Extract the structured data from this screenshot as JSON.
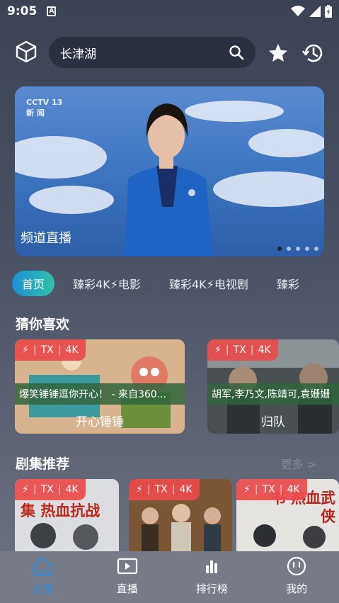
{
  "status": {
    "time": "9:05",
    "notification_letter": "A"
  },
  "search": {
    "query": "长津湖"
  },
  "banner": {
    "caption": "频道直播",
    "logo_text": "CCTV 13\n新 闻",
    "dots": 5,
    "active_dot": 0
  },
  "categories": [
    "首页",
    "臻彩4K⚡电影",
    "臻彩4K⚡电视剧",
    "臻彩"
  ],
  "guess": {
    "title": "猜你喜欢",
    "items": [
      {
        "tag": [
          "TX",
          "4K"
        ],
        "desc": "爆笑锤锤逗你开心！ - 来自360...",
        "name": "开心锤锤"
      },
      {
        "tag": [
          "TX",
          "4K"
        ],
        "desc": "胡军,李乃文,陈靖可,袁姗姗",
        "name": "归队"
      }
    ]
  },
  "series": {
    "title": "剧集推荐",
    "more": "更多 >",
    "items": [
      {
        "tag": [
          "TX",
          "4K"
        ],
        "poster_text": "集 热血抗战"
      },
      {
        "tag": [
          "TX",
          "4K"
        ],
        "poster_text": ""
      },
      {
        "tag": [
          "TX",
          "4K"
        ],
        "poster_text": "书 热血武侠"
      }
    ]
  },
  "tabs": [
    {
      "label": "点播",
      "icon": "home-icon",
      "active": true
    },
    {
      "label": "直播",
      "icon": "play-screen-icon",
      "active": false
    },
    {
      "label": "排行榜",
      "icon": "bar-chart-icon",
      "active": false
    },
    {
      "label": "我的",
      "icon": "profile-icon",
      "active": false
    }
  ],
  "colors": {
    "accent": "#2f8de0",
    "tag_red": "#e94a4a",
    "chip_active_start": "#1e90d6",
    "chip_active_end": "#2fc2a6"
  }
}
